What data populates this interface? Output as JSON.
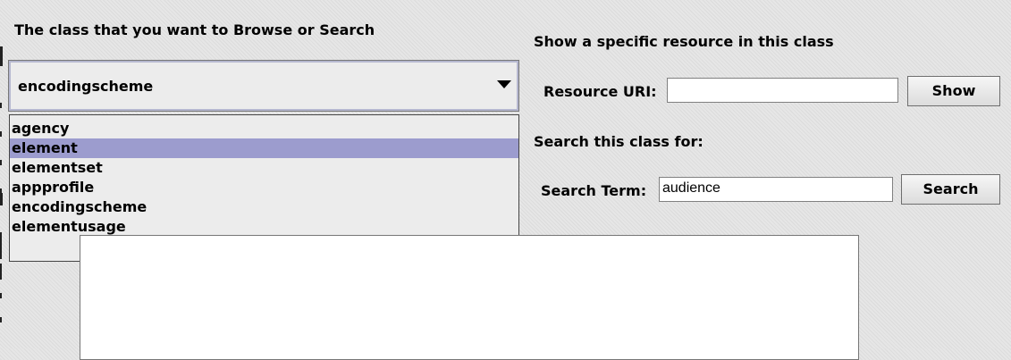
{
  "class_selector": {
    "heading": "The class that you want to Browse or Search",
    "selected_value": "encodingscheme",
    "options": [
      {
        "label": "agency"
      },
      {
        "label": "element"
      },
      {
        "label": "elementset"
      },
      {
        "label": "appprofile"
      },
      {
        "label": "encodingscheme"
      },
      {
        "label": "elementusage"
      }
    ],
    "highlighted_option": "element"
  },
  "show_resource": {
    "heading": "Show a specific resource in this class",
    "uri_label": "Resource URI:",
    "uri_value": "",
    "button_label": "Show"
  },
  "search": {
    "heading": "Search this class for:",
    "term_label": "Search Term:",
    "term_value": "audience",
    "button_label": "Search"
  },
  "colors": {
    "highlight": "#9c9cce",
    "background": "#e6e6e6",
    "field_background": "#ffffff"
  }
}
